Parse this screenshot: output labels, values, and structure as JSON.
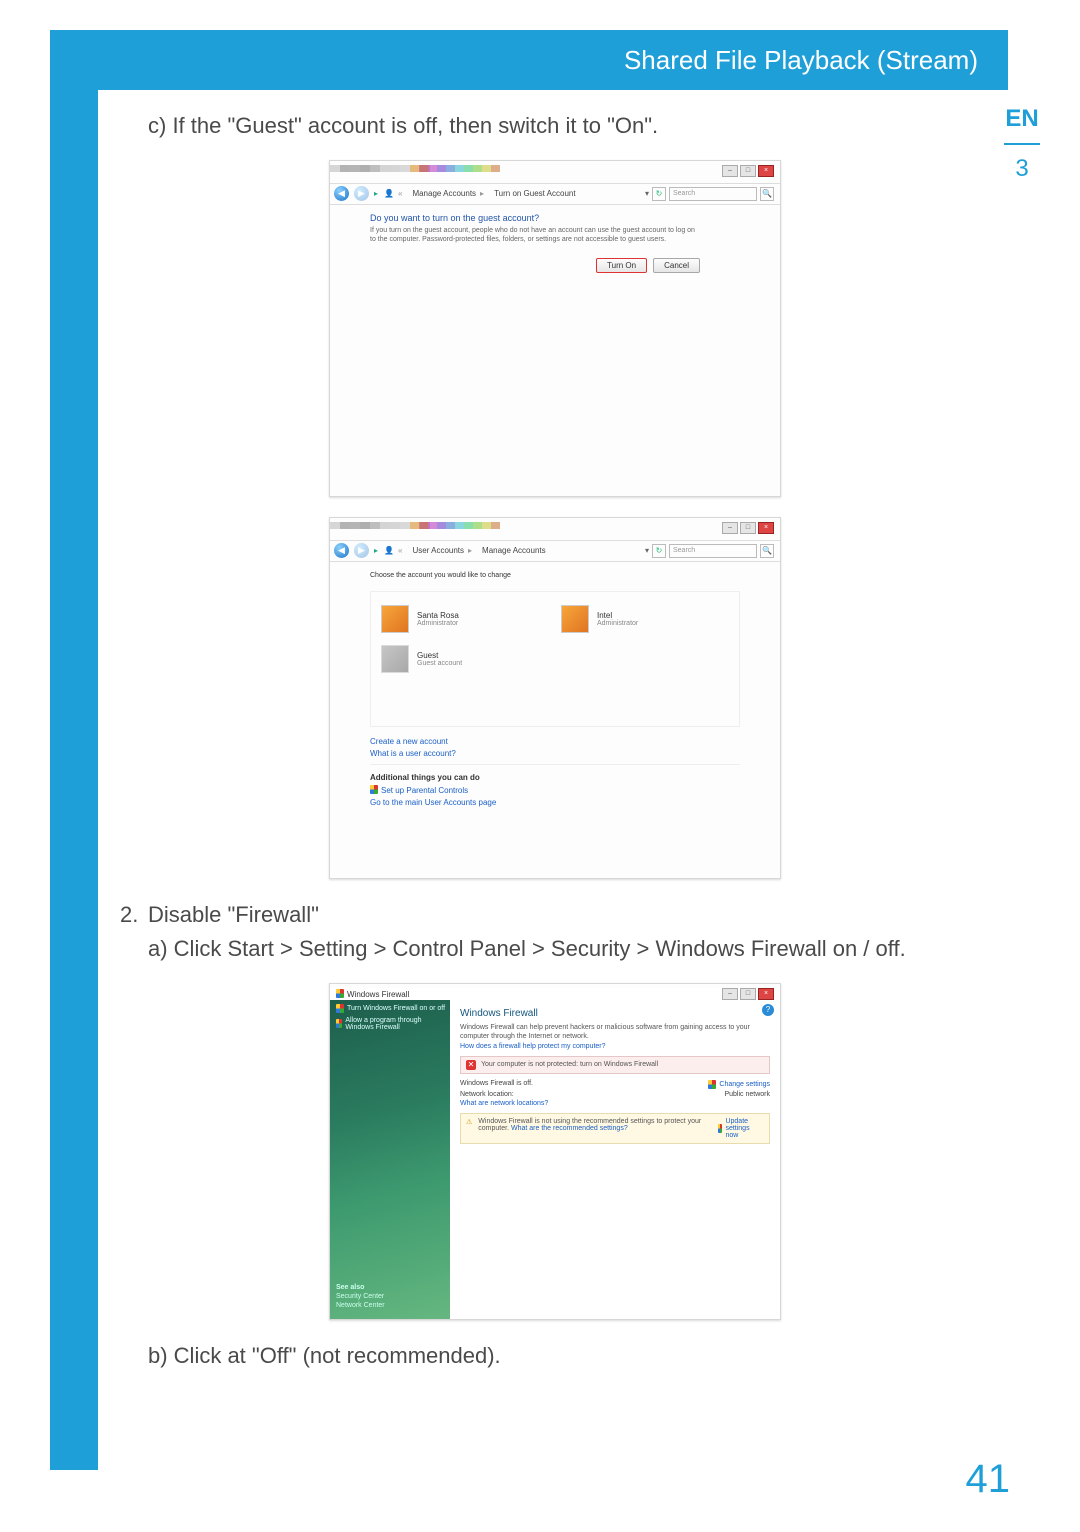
{
  "header": {
    "title": "Shared File Playback (Stream)"
  },
  "sideTab": {
    "lang": "EN",
    "chapter": "3"
  },
  "pageNumber": "41",
  "text": {
    "stepC": "c) If the \"Guest\" account is off, then switch it to \"On\".",
    "step2Num": "2.",
    "step2Title": "Disable \"Firewall\"",
    "step2a": "a) Click Start > Setting > Control Panel > Security > Windows Firewall on / off.",
    "step2b": "b) Click at \"Off\" (not recommended)."
  },
  "shot1": {
    "crumb1": "Manage Accounts",
    "crumb2": "Turn on Guest Account",
    "search": "Search",
    "question": "Do you want to turn on the guest account?",
    "desc": "If you turn on the guest account, people who do not have an account can use the guest account to log on to the computer. Password-protected files, folders, or settings are not accessible to guest users.",
    "btnOn": "Turn On",
    "btnCancel": "Cancel"
  },
  "shot2": {
    "crumb1": "User Accounts",
    "crumb2": "Manage Accounts",
    "search": "Search",
    "heading": "Choose the account you would like to change",
    "acct1Name": "Santa Rosa",
    "acct1Sub": "Administrator",
    "acct2Name": "Intel",
    "acct2Sub": "Administrator",
    "acct3Name": "Guest",
    "acct3Sub": "Guest account",
    "link1": "Create a new account",
    "link2": "What is a user account?",
    "addH": "Additional things you can do",
    "link3": "Set up Parental Controls",
    "link4": "Go to the main User Accounts page"
  },
  "shot3": {
    "title": "Windows Firewall",
    "leftLink1": "Turn Windows Firewall on or off",
    "leftLink2": "Allow a program through Windows Firewall",
    "seeAlso": "See also",
    "see1": "Security Center",
    "see2": "Network Center",
    "h": "Windows Firewall",
    "p": "Windows Firewall can help prevent hackers or malicious software from gaining access to your computer through the Internet or network.",
    "plink": "How does a firewall help protect my computer?",
    "alert": "Your computer is not protected: turn on Windows Firewall",
    "kv1k": "Windows Firewall is off.",
    "kv1v": "Change settings",
    "kv2k": "Network location:",
    "kv2v": "Public network",
    "kv3": "What are network locations?",
    "warn": "Windows Firewall is not using the recommended settings to protect your computer.",
    "warnLink": "What are the recommended settings?",
    "warnAction": "Update settings now"
  }
}
